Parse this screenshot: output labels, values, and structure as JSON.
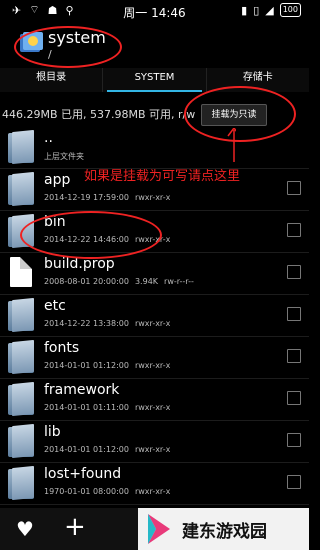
{
  "status_bar": {
    "time": "周一 14:46",
    "battery": "100"
  },
  "header": {
    "title": "system",
    "path": "/"
  },
  "tabs": [
    {
      "label": "根目录"
    },
    {
      "label": "SYSTEM"
    },
    {
      "label": "存储卡"
    }
  ],
  "info_bar": {
    "storage_text": "446.29MB 已用, 537.98MB 可用, r/w",
    "mount_button": "挂载为只读"
  },
  "annotation": "如果是挂载为可写请点这里",
  "files": [
    {
      "name": "..",
      "date": "上层文件夹",
      "size": "",
      "perms": ""
    },
    {
      "name": "app",
      "date": "2014-12-19 17:59:00",
      "size": "",
      "perms": "rwxr-xr-x"
    },
    {
      "name": "bin",
      "date": "2014-12-22 14:46:00",
      "size": "",
      "perms": "rwxr-xr-x"
    },
    {
      "name": "build.prop",
      "date": "2008-08-01 20:00:00",
      "size": "3.94K",
      "perms": "rw-r--r--"
    },
    {
      "name": "etc",
      "date": "2014-12-22 13:38:00",
      "size": "",
      "perms": "rwxr-xr-x"
    },
    {
      "name": "fonts",
      "date": "2014-01-01 01:12:00",
      "size": "",
      "perms": "rwxr-xr-x"
    },
    {
      "name": "framework",
      "date": "2014-01-01 01:11:00",
      "size": "",
      "perms": "rwxr-xr-x"
    },
    {
      "name": "lib",
      "date": "2014-01-01 01:12:00",
      "size": "",
      "perms": "rwxr-xr-x"
    },
    {
      "name": "lost+found",
      "date": "1970-01-01 08:00:00",
      "size": "",
      "perms": "rwxr-xr-x"
    }
  ],
  "watermark": "建东游戏园",
  "colors": {
    "accent": "#33b5e5",
    "annotation": "#e22222"
  }
}
